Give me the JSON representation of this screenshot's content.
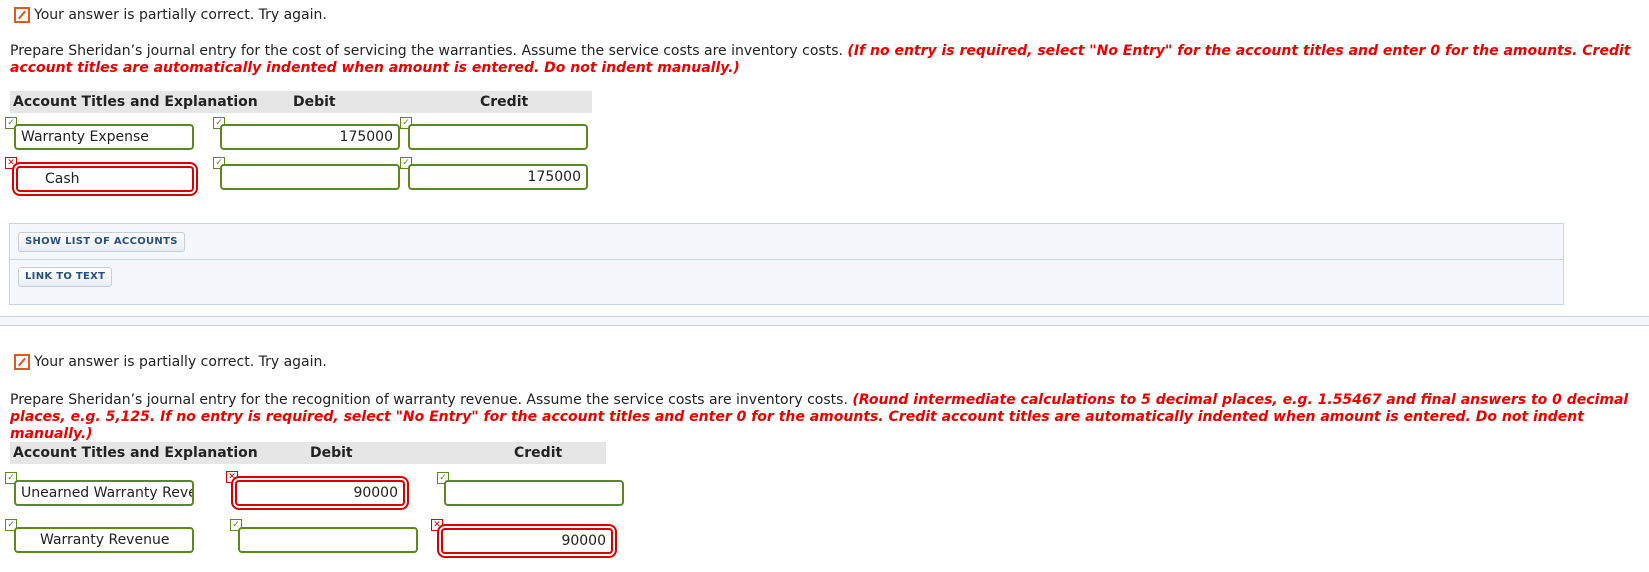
{
  "part1": {
    "status": {
      "icon": "edit-pencil-icon",
      "text": "Your answer is partially correct.  Try again."
    },
    "instructions": {
      "text": "Prepare Sheridan’s journal entry for the cost of servicing the warranties. Assume the service costs are inventory costs. ",
      "note": "(If no entry is required, select \"No Entry\" for the account titles and enter 0 for the amounts. Credit account titles are automatically indented when amount is entered. Do not indent manually.)"
    },
    "table": {
      "headers": {
        "account": "Account Titles and Explanation",
        "debit": "Debit",
        "credit": "Credit"
      },
      "rows": [
        {
          "account": "Warranty Expense",
          "account_status": "correct",
          "debit": "175000",
          "debit_status": "correct",
          "credit": "",
          "credit_status": "correct"
        },
        {
          "account": "Cash",
          "account_status": "incorrect",
          "debit": "",
          "debit_status": "correct",
          "credit": "175000",
          "credit_status": "correct"
        }
      ]
    },
    "buttons": {
      "show_accounts": "SHOW LIST OF ACCOUNTS",
      "link_to_text": "LINK TO TEXT"
    }
  },
  "part2": {
    "status": {
      "icon": "edit-pencil-icon",
      "text": "Your answer is partially correct.  Try again."
    },
    "instructions": {
      "text": "Prepare Sheridan’s journal entry for the recognition of warranty revenue. Assume the service costs are inventory costs. ",
      "note": "(Round intermediate calculations to 5 decimal places, e.g. 1.55467 and final answers to 0 decimal places, e.g. 5,125. If no entry is required, select \"No Entry\" for the account titles and enter 0 for the amounts. Credit account titles are automatically indented when amount is entered. Do not indent manually.)"
    },
    "table": {
      "headers": {
        "account": "Account Titles and Explanation",
        "debit": "Debit",
        "credit": "Credit"
      },
      "rows": [
        {
          "account": "Unearned Warranty Revenue",
          "account_status": "correct",
          "debit": "90000",
          "debit_status": "incorrect",
          "credit": "",
          "credit_status": "correct"
        },
        {
          "account": "Warranty Revenue",
          "account_status": "correct",
          "debit": "",
          "debit_status": "correct",
          "credit": "90000",
          "credit_status": "incorrect"
        }
      ]
    }
  },
  "marks": {
    "correct": "✓",
    "incorrect": "✕"
  },
  "colors": {
    "correct": "#5b8a1a",
    "incorrect": "#d80000",
    "note": "#e00000",
    "status_icon": "#e05a1e"
  }
}
